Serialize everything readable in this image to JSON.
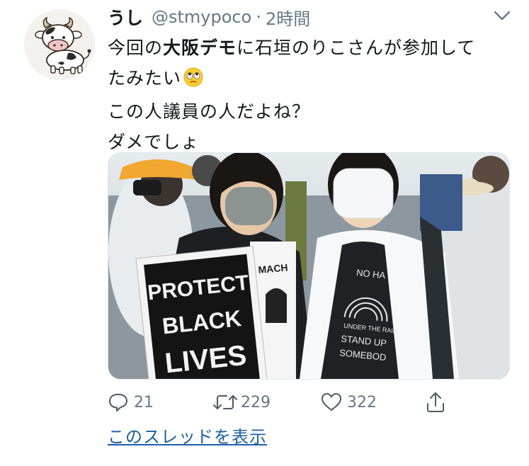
{
  "author": {
    "display_name": "うし",
    "handle": "@stmypoco",
    "separator": "·",
    "timestamp": "2時間"
  },
  "tweet": {
    "line1_a": "今回の",
    "line1_bold": "大阪デモ",
    "line1_b": "に石垣のりこさんが参加して",
    "line2": "たみたい",
    "line2_emoji": "rolling-eyes-emoji",
    "line3": "この人議員の人だよね？",
    "line4": "ダメでしょ"
  },
  "media": {
    "sign_lines": [
      "PROTECT",
      "BLACK",
      "LIVES"
    ],
    "shirt_left_text": "MACH",
    "shirt_right_lines": [
      "NO HA",
      "UNDER THE RAIN",
      "STAND UP",
      "SOMEBOD"
    ]
  },
  "actions": {
    "reply_count": "21",
    "retweet_count": "229",
    "like_count": "322"
  },
  "thread_link": "このスレッドを表示",
  "colors": {
    "secondary_text": "#657786",
    "link": "#1b5fa6",
    "text": "#14171a"
  }
}
